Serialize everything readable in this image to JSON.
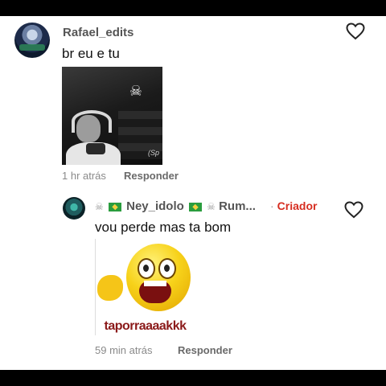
{
  "comments": [
    {
      "username": "Rafael_edits",
      "text": "br eu e tu",
      "time": "1 hr atrás",
      "reply_label": "Responder",
      "image_watermark": "(Sp"
    },
    {
      "username_display": "Ney_idolo",
      "username_suffix": "Rum...",
      "creator_label": "Criador",
      "text": "vou perde mas ta bom",
      "time": "59 min atrás",
      "reply_label": "Responder",
      "image_caption": "taporraaaakkk"
    }
  ],
  "colors": {
    "creator": "#d62d20",
    "background": "#ffffff",
    "bar": "#000000"
  },
  "icons": [
    "heart-outline-icon",
    "skull-icon",
    "brazil-flag-icon"
  ]
}
